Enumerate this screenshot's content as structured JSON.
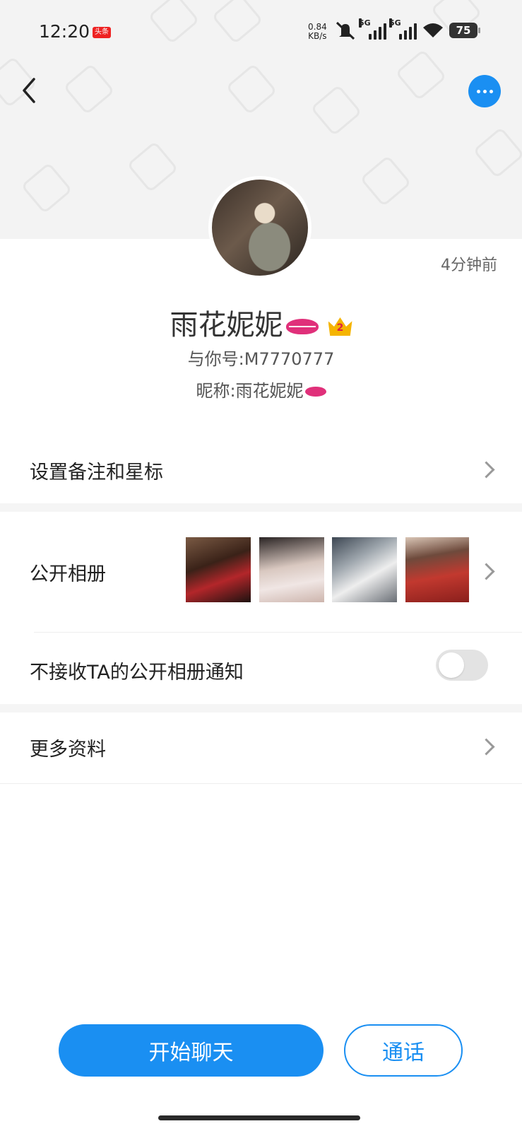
{
  "status_bar": {
    "time": "12:20",
    "app_badge": "头条",
    "net_speed_value": "0.84",
    "net_speed_unit": "KB/s",
    "signal_tag_1": "5G",
    "signal_tag_2": "5G",
    "battery": "75"
  },
  "profile": {
    "last_seen": "4分钟前",
    "name": "雨花妮妮",
    "vip_level": "2",
    "id_line": "与你号:M7770777",
    "nickname_line": "昵称:雨花妮妮"
  },
  "menu": {
    "remark_label": "设置备注和星标",
    "album_label": "公开相册",
    "notify_label": "不接收TA的公开相册通知",
    "more_label": "更多资料",
    "notify_toggle_on": false
  },
  "actions": {
    "chat_label": "开始聊天",
    "call_label": "通话"
  },
  "colors": {
    "accent": "#1a8ff2",
    "lips": "#e0307a",
    "crown": "#f5b400"
  },
  "icons": [
    "back-icon",
    "more-icon",
    "lips-icon",
    "crown-icon",
    "chevron-right-icon",
    "toggle-switch",
    "mute-icon",
    "wifi-icon",
    "battery-icon"
  ]
}
